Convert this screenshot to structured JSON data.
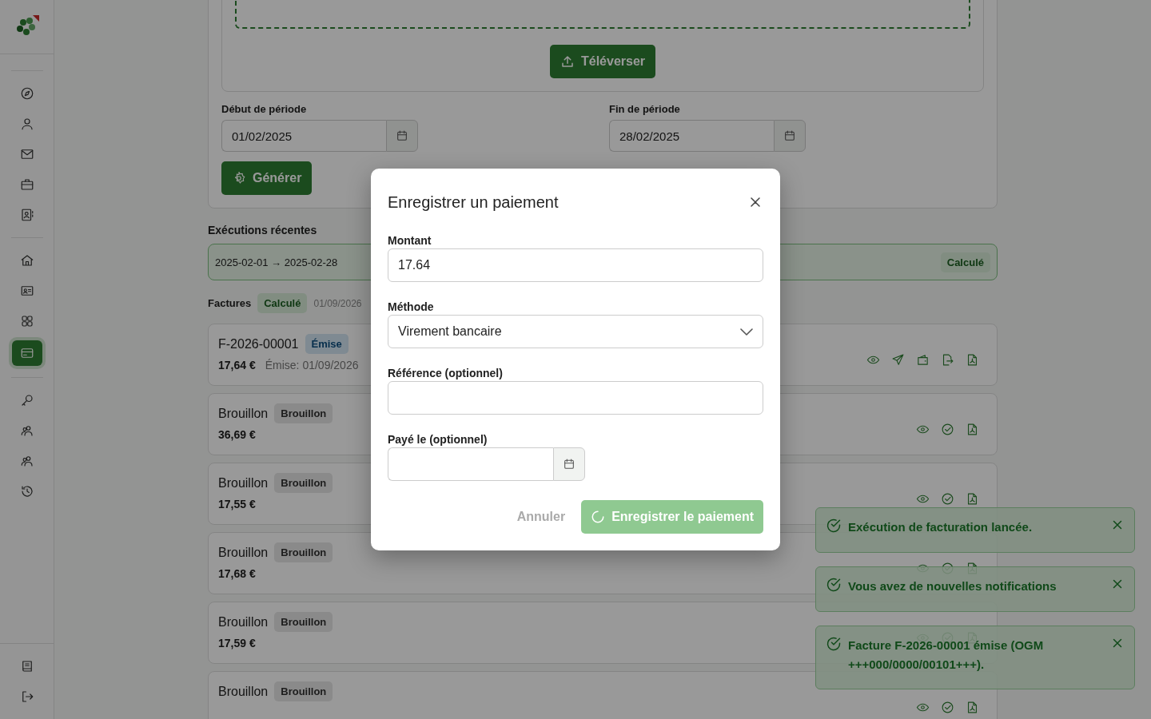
{
  "sidebar": {
    "groups": [
      [
        {
          "selected": false
        },
        {
          "selected": false
        },
        {
          "selected": false
        },
        {
          "selected": false
        },
        {
          "selected": false
        }
      ],
      [
        {
          "selected": false
        },
        {
          "selected": false
        },
        {
          "selected": false
        },
        {
          "selected": true
        }
      ],
      [
        {
          "selected": false
        },
        {
          "selected": false
        },
        {
          "selected": false
        },
        {
          "selected": false
        }
      ]
    ],
    "footer": [
      {
        "selected": false
      },
      {
        "selected": false
      }
    ]
  },
  "upload": {
    "button": "Téléverser"
  },
  "period": {
    "start": {
      "label": "Début de période",
      "value": "01/02/2025"
    },
    "end": {
      "label": "Fin de période",
      "value": "28/02/2025"
    }
  },
  "generate_button": "Générer",
  "recent_runs": {
    "title": "Exécutions récentes",
    "runs": [
      {
        "period": "2025-02-01 → 2025-02-28",
        "status": "Calculé"
      }
    ]
  },
  "invoices": {
    "title": "Factures",
    "status": "Calculé",
    "date": "01/09/2026",
    "rows": [
      {
        "title": "F-2026-00001",
        "badge": {
          "label": "Émise",
          "kind": "issued"
        },
        "amount": "17,64 €",
        "issued": "Émise: 01/09/2026",
        "actions": [
          {
            "kind": "view"
          },
          {
            "kind": "send"
          },
          {
            "kind": "wallet"
          },
          {
            "kind": "export"
          },
          {
            "kind": "pdf"
          }
        ]
      },
      {
        "title": "Brouillon",
        "badge": {
          "label": "Brouillon",
          "kind": "draft"
        },
        "amount": "36,69 €",
        "actions": [
          {
            "kind": "view"
          },
          {
            "kind": "approve"
          },
          {
            "kind": "pdf"
          }
        ]
      },
      {
        "title": "Brouillon",
        "badge": {
          "label": "Brouillon",
          "kind": "draft"
        },
        "amount": "17,55 €",
        "actions": [
          {
            "kind": "view"
          },
          {
            "kind": "approve"
          },
          {
            "kind": "pdf"
          }
        ]
      },
      {
        "title": "Brouillon",
        "badge": {
          "label": "Brouillon",
          "kind": "draft"
        },
        "amount": "17,68 €",
        "actions": [
          {
            "kind": "view"
          },
          {
            "kind": "approve"
          },
          {
            "kind": "pdf"
          }
        ]
      },
      {
        "title": "Brouillon",
        "badge": {
          "label": "Brouillon",
          "kind": "draft"
        },
        "amount": "17,59 €",
        "actions": [
          {
            "kind": "view"
          },
          {
            "kind": "approve"
          },
          {
            "kind": "pdf"
          }
        ]
      },
      {
        "title": "Brouillon",
        "badge": {
          "label": "Brouillon",
          "kind": "draft"
        },
        "actions": [
          {
            "kind": "view"
          },
          {
            "kind": "approve"
          },
          {
            "kind": "pdf"
          }
        ]
      }
    ]
  },
  "dialog": {
    "title": "Enregistrer un paiement",
    "amount": {
      "label": "Montant",
      "value": "17.64"
    },
    "method": {
      "label": "Méthode",
      "value": "Virement bancaire"
    },
    "reference": {
      "label": "Référence (optionnel)"
    },
    "paid_on": {
      "label": "Payé le (optionnel)"
    },
    "cancel": "Annuler",
    "submit": "Enregistrer le paiement",
    "submitting": true
  },
  "toasts": [
    {
      "message": "Exécution de facturation lancée."
    },
    {
      "message": "Vous avez de nouvelles notifications"
    },
    {
      "message": "Facture F-2026-00001 émise (OGM +++000/0000/00101+++)."
    }
  ]
}
